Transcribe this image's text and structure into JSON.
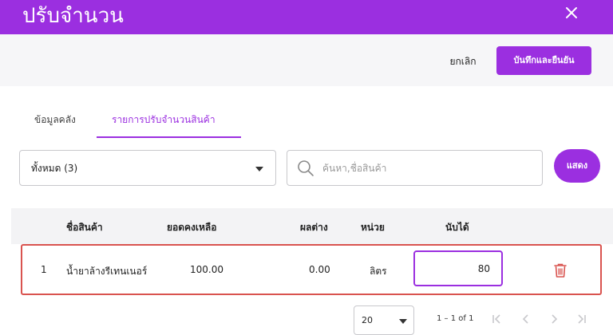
{
  "header": {
    "title": "ปรับจำนวน"
  },
  "actions": {
    "cancel_label": "ยกเลิก",
    "save_label": "บันทึกและยืนยัน"
  },
  "tabs": [
    {
      "label": "ข้อมูลคลัง",
      "active": false
    },
    {
      "label": "รายการปรับจำนวนสินค้า",
      "active": true
    }
  ],
  "filter": {
    "selected": "ทั้งหมด (3)"
  },
  "search": {
    "placeholder": "ค้นหา,ชื่อสินค้า",
    "value": ""
  },
  "show_button": {
    "label": "แสดง"
  },
  "table": {
    "columns": [
      "ชื่อสินค้า",
      "ยอดคงเหลือ",
      "ผลต่าง",
      "หน่วย",
      "นับได้"
    ],
    "rows": [
      {
        "no": "1",
        "name": "น้ำยาล้างรีเทนเนอร์",
        "balance": "100.00",
        "diff": "0.00",
        "unit": "ลิตร",
        "counted": "80"
      }
    ]
  },
  "pagination": {
    "page_size": "20",
    "range": "1 – 1 of 1"
  },
  "colors": {
    "accent": "#9b2fe0",
    "error_border": "#d9534f",
    "trash": "#d9534f"
  },
  "icons": [
    "close-icon",
    "chevron-down-icon",
    "search-icon",
    "trash-icon",
    "first-page-icon",
    "prev-page-icon",
    "next-page-icon",
    "last-page-icon"
  ]
}
